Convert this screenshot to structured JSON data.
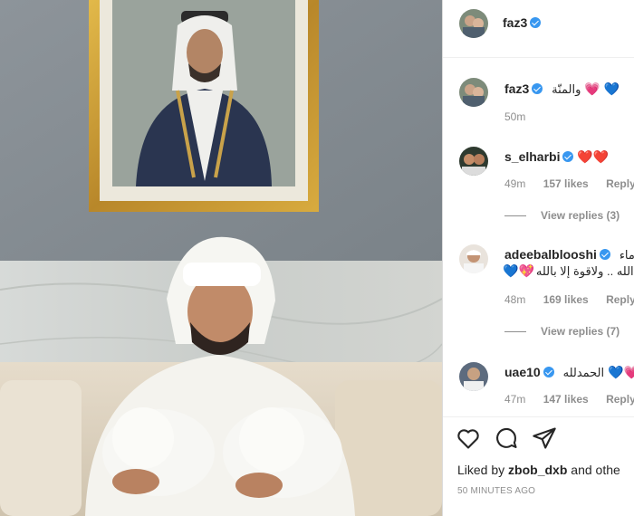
{
  "post": {
    "author": "faz3"
  },
  "caption": {
    "author": "faz3",
    "text": "والمنّة",
    "hearts": [
      "💗",
      "💙"
    ],
    "time": "50m"
  },
  "comments": [
    {
      "username": "s_elharbi",
      "text": "",
      "hearts": [
        "❤️",
        "❤️"
      ],
      "time": "49m",
      "likes": "157 likes",
      "reply": "Reply",
      "view_replies": "View replies (3)"
    },
    {
      "username": "adeebalblooshi",
      "text_line1": "ماء",
      "text_line2": "الله .. ولاقوة إلا بالله..",
      "hearts": [
        "💙",
        "💖"
      ],
      "time": "48m",
      "likes": "169 likes",
      "reply": "Reply",
      "view_replies": "View replies (7)"
    },
    {
      "username": "uae10",
      "text": "الحمدلله",
      "hearts": [
        "💙",
        "💗"
      ],
      "time": "47m",
      "likes": "147 likes",
      "reply": "Reply"
    }
  ],
  "actions": {
    "like_icon": "heart-outline-icon",
    "comment_icon": "comment-bubble-icon",
    "share_icon": "paper-plane-icon"
  },
  "liked_by": {
    "prefix": "Liked by",
    "user": "zbob_dxb",
    "suffix": "and othe"
  },
  "posted_ago": "50 MINUTES AGO",
  "colors": {
    "verified": "#3897f0",
    "meta_gray": "#8e8e8e",
    "divider": "#dbdbdb"
  }
}
